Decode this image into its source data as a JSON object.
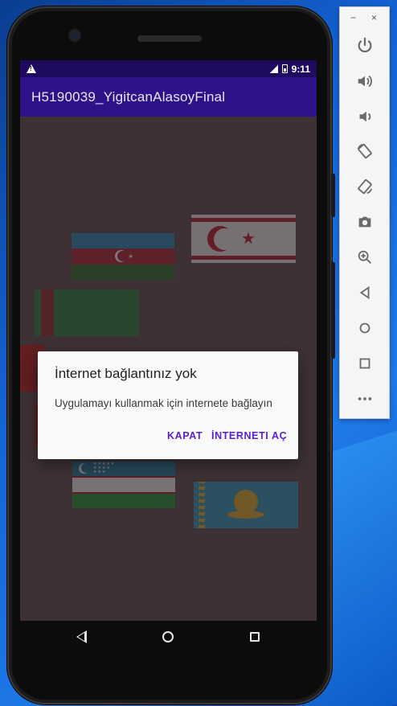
{
  "app": {
    "title": "H5190039_YigitcanAlasoyFinal"
  },
  "status_bar": {
    "time": "9:11",
    "warning_icon": "warning-icon",
    "signal_icon": "signal-icon",
    "battery_icon": "battery-icon"
  },
  "dialog": {
    "title": "İnternet bağlantınız yok",
    "message": "Uygulamayı kullanmak için internete bağlayın",
    "buttons": {
      "cancel_label": "KAPAT",
      "confirm_label": "İNTERNETI AÇ"
    },
    "accent_color": "#5a1ed0"
  },
  "flags": [
    "flag-azerbaijan",
    "flag-northern-cyprus",
    "flag-turkmenistan",
    "flag-turkey",
    "flag-kyrgyzstan",
    "flag-uzbekistan",
    "flag-kazakhstan"
  ],
  "nav_bar": {
    "back_icon": "back-triangle-icon",
    "home_icon": "home-circle-icon",
    "recents_icon": "recents-square-icon"
  },
  "emulator_toolbar": {
    "minimize_label": "−",
    "close_label": "×",
    "buttons": [
      "power-icon",
      "volume-up-icon",
      "volume-down-icon",
      "rotate-left-icon",
      "rotate-right-icon",
      "camera-icon",
      "zoom-icon",
      "back-icon",
      "home-icon",
      "overview-icon",
      "more-icon"
    ]
  },
  "colors": {
    "status_bar": "#1e0a5e",
    "app_bar": "#2e1289",
    "screen_background": "#5a4a4f"
  }
}
